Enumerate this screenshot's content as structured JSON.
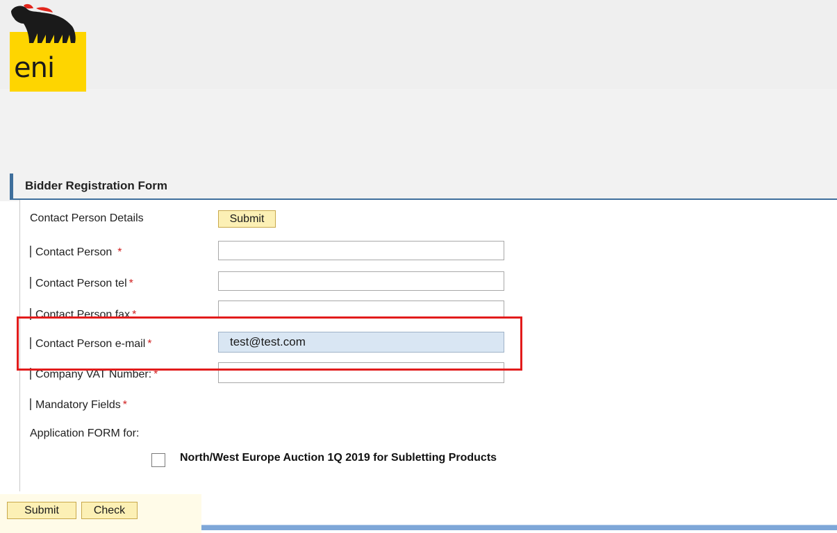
{
  "brand": {
    "logo_text": "eni",
    "colors": {
      "yellow": "#fed500",
      "accent": "#3f6f9c",
      "button": "#fcf0b5",
      "highlight": "#e21b1b"
    }
  },
  "form": {
    "title": "Bidder Registration Form",
    "section_label": "Contact Person Details",
    "section_submit_label": "Submit",
    "required_marker": "*",
    "fields": [
      {
        "label": "Contact Person",
        "value": ""
      },
      {
        "label": "Contact Person tel",
        "value": ""
      },
      {
        "label": "Contact Person fax",
        "value": ""
      },
      {
        "label": "Contact Person e-mail",
        "value": "test@test.com"
      },
      {
        "label": "Company VAT Number:",
        "value": ""
      }
    ],
    "mandatory_note": "Mandatory Fields",
    "application_label": "Application FORM for:",
    "option_label": "North/West Europe Auction 1Q 2019 for Subletting Products",
    "option_checked": false
  },
  "footer": {
    "submit_label": "Submit",
    "check_label": "Check"
  }
}
